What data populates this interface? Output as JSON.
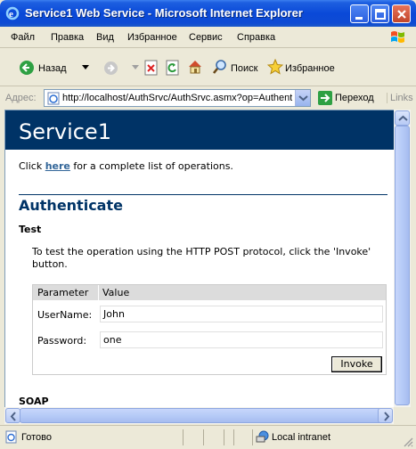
{
  "window": {
    "title": "Service1 Web Service - Microsoft Internet Explorer"
  },
  "menu": [
    "Файл",
    "Правка",
    "Вид",
    "Избранное",
    "Сервис",
    "Справка"
  ],
  "toolbar": {
    "back_label": "Назад",
    "search_label": "Поиск",
    "favorites_label": "Избранное"
  },
  "address": {
    "label": "Адрес:",
    "url": "http://localhost/AuthSrvc/AuthSrvc.asmx?op=Authenticate",
    "go_label": "Переход",
    "links_label": "Links"
  },
  "page": {
    "service_title": "Service1",
    "intro_before": "Click ",
    "intro_link": "here",
    "intro_after": " for a complete list of operations.",
    "operation_title": "Authenticate",
    "test_title": "Test",
    "test_description": "To test the operation using the HTTP POST protocol, click the 'Invoke' button.",
    "params": {
      "header_param": "Parameter",
      "header_value": "Value",
      "rows": [
        {
          "label": "UserName:",
          "value": "John"
        },
        {
          "label": "Password:",
          "value": "one"
        }
      ],
      "invoke_label": "Invoke"
    },
    "soap_title": "SOAP"
  },
  "status": {
    "text": "Готово",
    "zone": "Local intranet"
  },
  "colors": {
    "heading_band": "#003366",
    "link": "#336699",
    "titlebar": "#0a49d8"
  }
}
